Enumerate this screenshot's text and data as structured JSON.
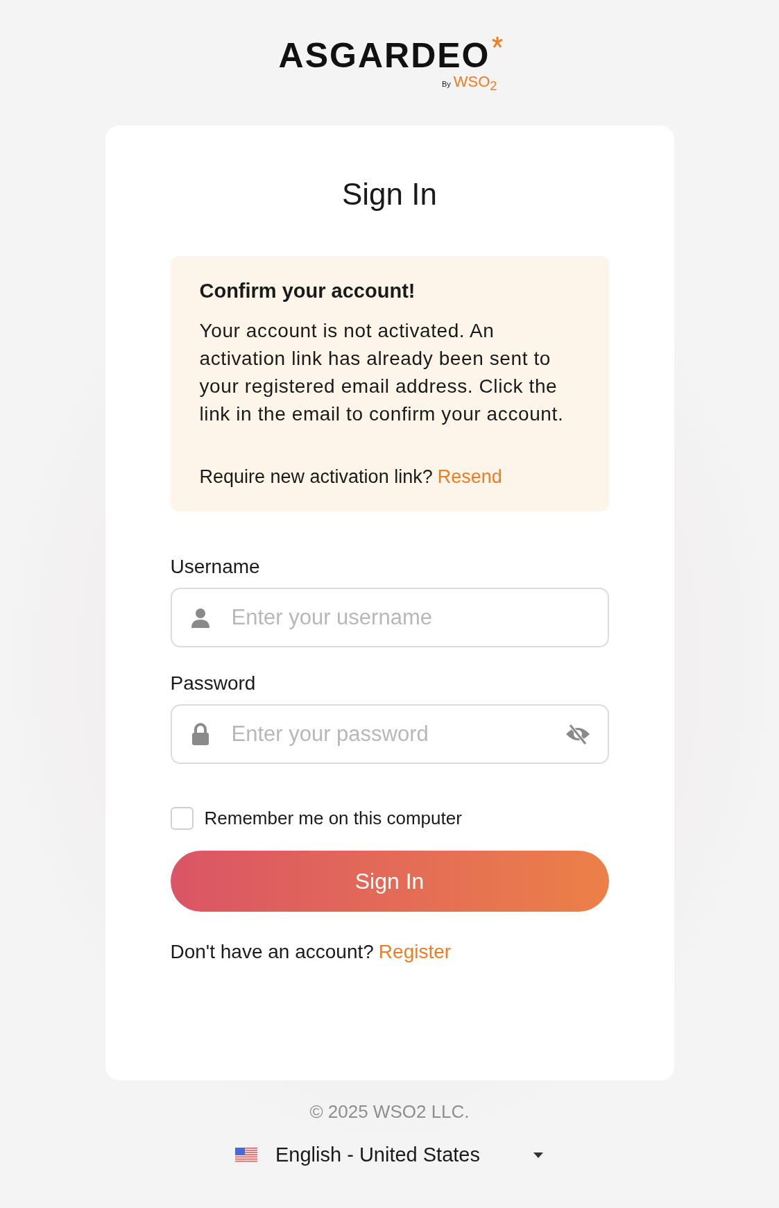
{
  "logo": {
    "name": "ASGARDEO",
    "by": "By",
    "brand": "WSO$_{2}$"
  },
  "title": "Sign In",
  "alert": {
    "heading": "Confirm your account!",
    "message": "Your account is not activated. An activation link has already been sent to your registered email address. Click the link in the email to confirm your account.",
    "prompt": "Require new activation link?",
    "link": "Resend"
  },
  "fields": [
    {
      "kind": "username",
      "label": "Username",
      "placeholder": "Enter your username"
    },
    {
      "kind": "password",
      "label": "Password",
      "placeholder": "Enter your password"
    }
  ],
  "remember": {
    "label": "Remember me on this computer",
    "checked": false
  },
  "submit": "Sign In",
  "register": {
    "prompt": "Don't have an account?",
    "link": "Register"
  },
  "footer": {
    "copyright": "© 2025 WSO2 LLC.",
    "language": "English - United States"
  }
}
